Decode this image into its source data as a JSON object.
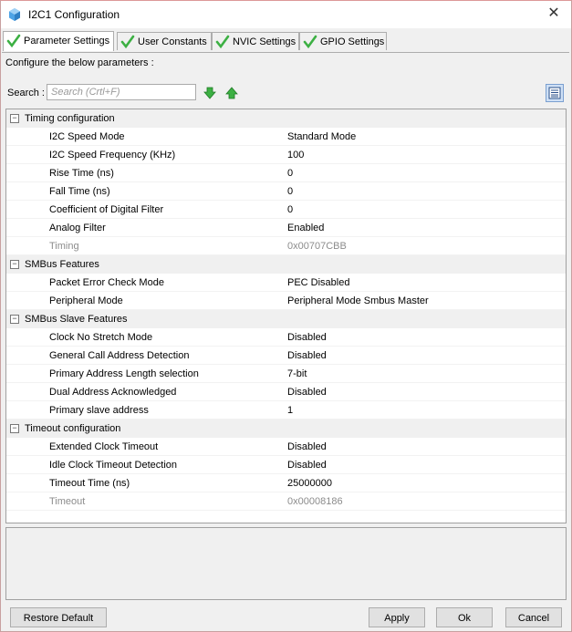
{
  "window": {
    "title": "I2C1 Configuration"
  },
  "tabs": [
    {
      "label": "Parameter Settings"
    },
    {
      "label": "User Constants"
    },
    {
      "label": "NVIC Settings"
    },
    {
      "label": "GPIO Settings"
    }
  ],
  "panel": {
    "hint": "Configure the below parameters :",
    "search_label": "Search :",
    "search_placeholder": "Search (Crtl+F)"
  },
  "groups": [
    {
      "title": "Timing configuration",
      "params": [
        {
          "name": "I2C Speed Mode",
          "value": "Standard Mode"
        },
        {
          "name": "I2C Speed Frequency (KHz)",
          "value": "100"
        },
        {
          "name": "Rise Time (ns)",
          "value": "0"
        },
        {
          "name": "Fall Time (ns)",
          "value": "0"
        },
        {
          "name": "Coefficient of Digital Filter",
          "value": "0"
        },
        {
          "name": "Analog Filter",
          "value": "Enabled"
        },
        {
          "name": "Timing",
          "value": "0x00707CBB"
        }
      ]
    },
    {
      "title": "SMBus Features",
      "params": [
        {
          "name": "Packet Error Check Mode",
          "value": "PEC Disabled"
        },
        {
          "name": "Peripheral Mode",
          "value": "Peripheral Mode Smbus Master"
        }
      ]
    },
    {
      "title": "SMBus Slave Features",
      "params": [
        {
          "name": "Clock No Stretch Mode",
          "value": "Disabled"
        },
        {
          "name": "General Call Address Detection",
          "value": "Disabled"
        },
        {
          "name": "Primary Address Length selection",
          "value": "7-bit"
        },
        {
          "name": "Dual Address Acknowledged",
          "value": "Disabled"
        },
        {
          "name": "Primary slave address",
          "value": "1"
        }
      ]
    },
    {
      "title": "Timeout configuration",
      "params": [
        {
          "name": "Extended Clock Timeout",
          "value": "Disabled"
        },
        {
          "name": "Idle Clock Timeout Detection",
          "value": "Disabled"
        },
        {
          "name": "Timeout Time (ns)",
          "value": "25000000"
        },
        {
          "name": "Timeout",
          "value": "0x00008186"
        }
      ]
    }
  ],
  "buttons": {
    "restore": "Restore Default",
    "apply": "Apply",
    "ok": "Ok",
    "cancel": "Cancel"
  },
  "icons": {
    "app": "cube-icon",
    "tab_check": "green-check-icon",
    "find_next": "green-arrow-down-icon",
    "find_prev": "green-arrow-up-icon",
    "list_view": "list-view-icon"
  },
  "colors": {
    "check_green": "#3cb043",
    "readonly_text": "#8c8c8c",
    "group_row_bg": "#f0f0f0"
  }
}
